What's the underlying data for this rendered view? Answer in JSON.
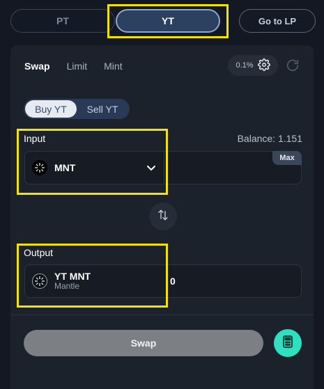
{
  "top_tabs": {
    "pt": "PT",
    "yt": "YT",
    "go_to_lp": "Go to LP"
  },
  "modes": {
    "swap": "Swap",
    "limit": "Limit",
    "mint": "Mint"
  },
  "slippage": "0.1%",
  "buy_sell": {
    "buy": "Buy YT",
    "sell": "Sell YT"
  },
  "input": {
    "label": "Input",
    "balance": "Balance: 1.151",
    "token": "MNT",
    "max": "Max"
  },
  "output": {
    "label": "Output",
    "token": "YT MNT",
    "token_sub": "Mantle",
    "amount": "0"
  },
  "action": {
    "swap": "Swap"
  },
  "colors": {
    "accent": "#2fe0c0",
    "highlight": "#f5e400",
    "active_tab": "#2c4060"
  }
}
